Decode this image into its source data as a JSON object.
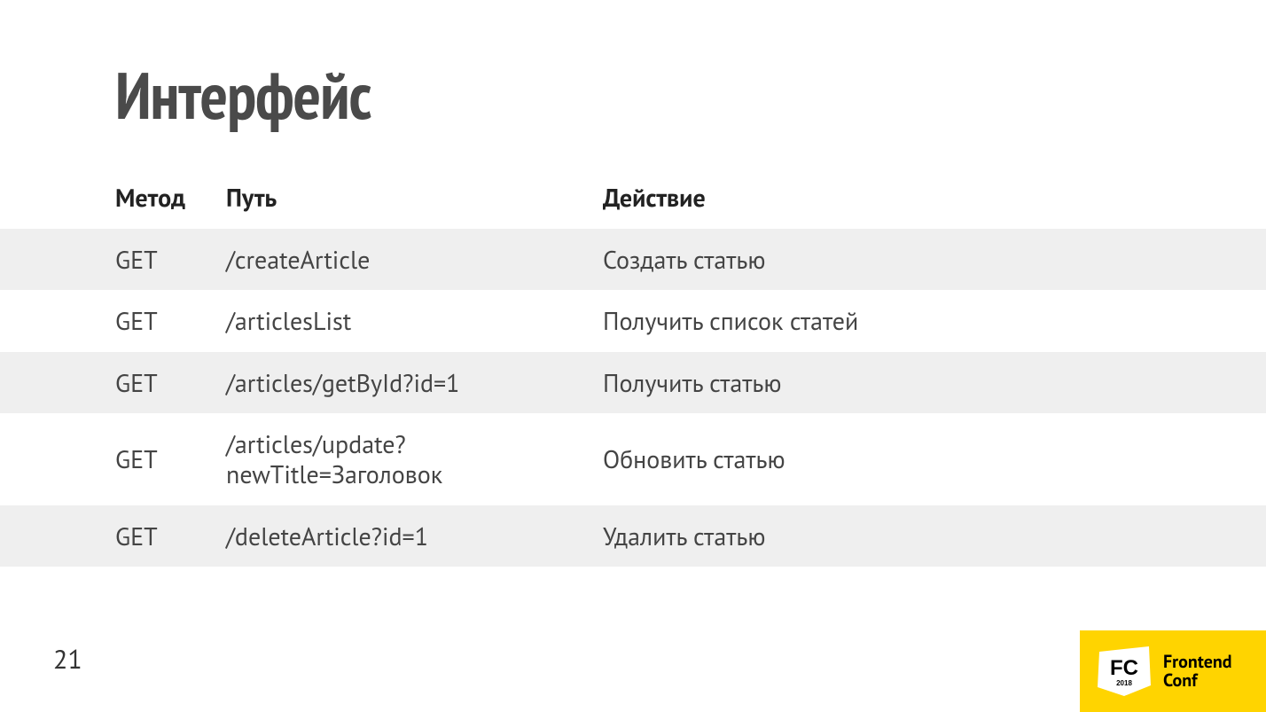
{
  "title": "Интерфейс",
  "page_number": "21",
  "logo": {
    "badge_text": "FC",
    "badge_year": "2018",
    "name_line1": "Frontend",
    "name_line2": "Conf"
  },
  "table": {
    "headers": {
      "method": "Метод",
      "path": "Путь",
      "action": "Действие"
    },
    "rows": [
      {
        "method": "GET",
        "path": "/createArticle",
        "action": "Создать статью"
      },
      {
        "method": "GET",
        "path": "/articlesList",
        "action": "Получить список статей"
      },
      {
        "method": "GET",
        "path": "/articles/getById?id=1",
        "action": "Получить статью"
      },
      {
        "method": "GET",
        "path": "/articles/update?newTitle=Заголовок",
        "action": "Обновить статью"
      },
      {
        "method": "GET",
        "path": "/deleteArticle?id=1",
        "action": "Удалить статью"
      }
    ]
  }
}
